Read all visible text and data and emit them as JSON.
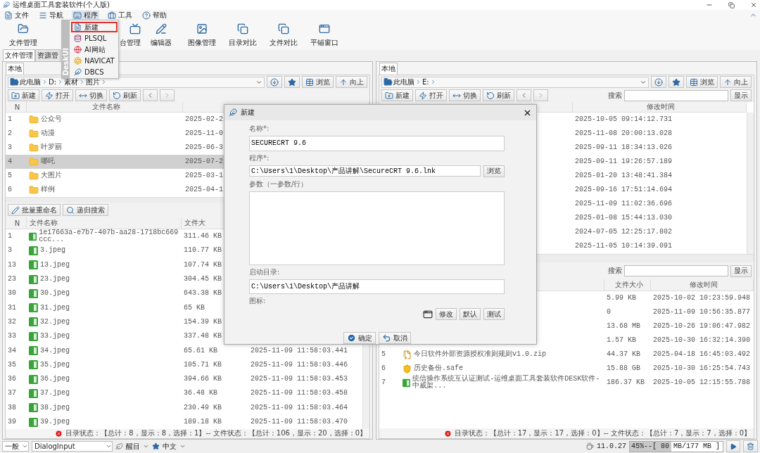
{
  "window": {
    "title": "运维桌面工具套装软件(个人版)"
  },
  "menu_bar": [
    {
      "label": "文件",
      "open": false
    },
    {
      "label": "导航",
      "open": false
    },
    {
      "label": "程序",
      "open": true
    },
    {
      "label": "工具",
      "open": false
    },
    {
      "label": "帮助",
      "open": false
    }
  ],
  "program_menu": {
    "side_label": "DeskUI",
    "items": [
      {
        "label": "新建",
        "selected": true
      },
      {
        "label": "PLSQL",
        "selected": false
      },
      {
        "label": "AI网站",
        "selected": false
      },
      {
        "label": "NAVICAT",
        "selected": false
      },
      {
        "label": "DBCS",
        "selected": false
      }
    ]
  },
  "toolbar": [
    "文件管理",
    "台管理",
    "编辑器",
    "图像管理",
    "目录对比",
    "文件对比",
    "平铺窗口"
  ],
  "left_pane": {
    "tabs": [
      {
        "label": "文件管理",
        "selected": true
      },
      {
        "label": "资源管",
        "selected": false
      }
    ],
    "local_tab": "本地",
    "path": [
      "此电脑",
      "D:",
      "素材",
      "图片"
    ],
    "nav_buttons": [
      "浏览",
      "向上"
    ],
    "actions": [
      "新建",
      "打开",
      "切换",
      "刷新"
    ],
    "dir_table": {
      "header": {
        "n": "N",
        "name": "文件名称"
      },
      "rows": [
        {
          "n": "1",
          "name": "公众号",
          "modified": "2025-02-2",
          "selected": false
        },
        {
          "n": "2",
          "name": "动漫",
          "modified": "2025-11-0",
          "selected": false
        },
        {
          "n": "3",
          "name": "叶罗丽",
          "modified": "2025-06-3",
          "selected": false
        },
        {
          "n": "4",
          "name": "哪吒",
          "modified": "2025-07-2",
          "selected": true
        },
        {
          "n": "5",
          "name": "大图片",
          "modified": "2025-03-1",
          "selected": false
        },
        {
          "n": "6",
          "name": "样例",
          "modified": "2025-04-1",
          "selected": false
        }
      ]
    },
    "file_actions": [
      "批量重命名",
      "递归搜索"
    ],
    "file_table": {
      "header": {
        "n": "N",
        "name": "文件名称",
        "size": "文件大"
      },
      "rows": [
        {
          "n": "1",
          "kind": "image",
          "name": "1e17663a-e7b7-407b-aa28-1718bc669ccc...",
          "size": "311.46 KB"
        },
        {
          "n": "3",
          "kind": "image",
          "name": "3.jpeg",
          "size": "110.77 KB"
        },
        {
          "n": "13",
          "kind": "image",
          "name": "13.jpeg",
          "size": "107.74 KB"
        },
        {
          "n": "23",
          "kind": "image",
          "name": "23.jpeg",
          "size": "304.45 KB"
        },
        {
          "n": "30",
          "kind": "image",
          "name": "30.jpeg",
          "size": "643.38 KB"
        },
        {
          "n": "31",
          "kind": "image",
          "name": "31.jpeg",
          "size": "65 KB"
        },
        {
          "n": "32",
          "kind": "image",
          "name": "32.jpeg",
          "size": "154.39 KB"
        },
        {
          "n": "33",
          "kind": "image",
          "name": "33.jpeg",
          "size": "337.48 KB"
        },
        {
          "n": "34",
          "kind": "image",
          "name": "34.jpeg",
          "size": "65.61 KB",
          "modified": "2025-11-09 11:58:03.441"
        },
        {
          "n": "35",
          "kind": "image",
          "name": "35.jpeg",
          "size": "105.71 KB",
          "modified": "2025-11-09 11:58:03.446"
        },
        {
          "n": "36",
          "kind": "image",
          "name": "36.jpeg",
          "size": "394.66 KB",
          "modified": "2025-11-09 11:58:03.453"
        },
        {
          "n": "37",
          "kind": "image",
          "name": "37.jpeg",
          "size": "36.48 KB",
          "modified": "2025-11-09 11:58:03.458"
        },
        {
          "n": "38",
          "kind": "image",
          "name": "38.jpeg",
          "size": "230.49 KB",
          "modified": "2025-11-09 11:58:03.464"
        },
        {
          "n": "39",
          "kind": "image",
          "name": "39.jpeg",
          "size": "189.18 KB",
          "modified": "2025-11-09 11:58:03.470"
        }
      ]
    },
    "status": "目录状态：【总计：8，显示：8，选择：1】-- 文件状态：【总计：106，显示：20，选择：0】"
  },
  "right_pane": {
    "local_tab": "本地",
    "path": [
      "此电脑",
      "E:"
    ],
    "nav_buttons": [
      "浏览",
      "向上"
    ],
    "actions": [
      "新建",
      "打开",
      "切换",
      "刷新"
    ],
    "search": {
      "label": "搜索",
      "button": "显示"
    },
    "dir_table": {
      "header": {
        "modified": "修改时间"
      },
      "rows": [
        {
          "modified": "2025-10-05 09:14:12.731"
        },
        {
          "modified": "2025-11-08 20:00:13.028"
        },
        {
          "modified": "2025-09-11 18:34:13.026"
        },
        {
          "modified": "2025-09-11 19:26:57.189"
        },
        {
          "modified": "2025-01-20 13:48:41.384"
        },
        {
          "modified": "2025-09-16 17:51:14.694"
        },
        {
          "modified": "2025-11-09 11:02:36.696"
        },
        {
          "modified": "2025-01-08 15:44:13.030"
        },
        {
          "modified": "2024-07-05 12:25:17.802"
        },
        {
          "modified": "2025-11-05 10:14:39.091"
        }
      ]
    },
    "file_search": {
      "label": "搜索",
      "button": "显示"
    },
    "file_table": {
      "header": {
        "size": "文件大小",
        "modified": "修改时间"
      },
      "rows": [
        {
          "size": "5.99 KB",
          "modified": "2025-10-02 10:23:59.948"
        },
        {
          "size": "0",
          "modified": "2025-11-09 10:56:35.877"
        },
        {
          "size": "13.68 MB",
          "modified": "2025-10-26 19:06:47.982"
        },
        {
          "size": "1.57 KB",
          "modified": "2025-10-30 16:32:14.390"
        },
        {
          "n": "5",
          "kind": "zip",
          "name": "今日软件外部资源授权准则规则v1.0.zip",
          "size": "44.37 KB",
          "modified": "2025-04-18 16:45:03.492"
        },
        {
          "n": "6",
          "kind": "safe",
          "name": "历史备份.safe",
          "size": "15.88 GB",
          "modified": "2025-10-30 16:25:54.743"
        },
        {
          "n": "7",
          "kind": "doc",
          "name": "统信操作系统互认证测试-运维桌面工具套装软件DESK软件-中威架...",
          "size": "186.37 KB",
          "modified": "2025-10-05 12:15:55.788"
        }
      ]
    },
    "status": "目录状态：【总计：17，显示：17，选择：0】-- 文件状态：【总计：7，显示：7，选择：0】"
  },
  "dialog": {
    "title": "新建",
    "fields": [
      {
        "kind": "text",
        "label": "名称*:",
        "value": "SECURECRT 9.6"
      },
      {
        "kind": "browse",
        "label": "程序*:",
        "value": "C:\\Users\\1\\Desktop\\产品讲解\\SecureCRT 9.6.lnk",
        "button": "浏览"
      },
      {
        "kind": "textarea",
        "label": "参数（一参数/行）"
      },
      {
        "kind": "text",
        "label": "启动目录:",
        "value": "C:\\Users\\1\\Desktop\\产品讲解"
      }
    ],
    "icon_label": "图标:",
    "icon_buttons": [
      "修改",
      "默认",
      "测试"
    ],
    "buttons": [
      "确定",
      "取消"
    ]
  },
  "status_bar": {
    "style": "一般",
    "font": "DialogInput",
    "effect": "醒目",
    "language": "中文",
    "java_version": "11.0.27",
    "memory": {
      "label": "45%--[ 80 MB/177 MB ]",
      "level": 0.45
    }
  }
}
